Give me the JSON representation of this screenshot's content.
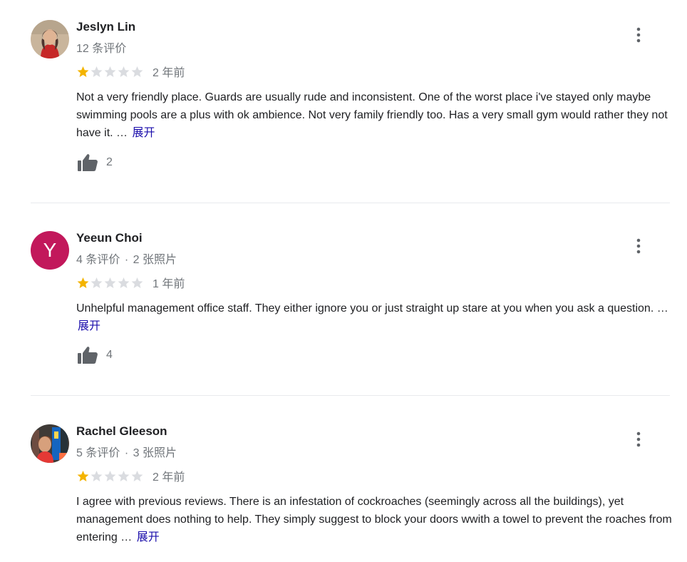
{
  "reviews": [
    {
      "author": "Jeslyn Lin",
      "meta": "12 条评价",
      "photos": "",
      "rating": 1,
      "max_rating": 5,
      "time": "2 年前",
      "text": "Not a very friendly place. Guards are usually rude and inconsistent. One of the worst place i've stayed only maybe swimming pools are a plus with ok ambience. Not very family friendly too. Has a very small gym would rather they not have it. …",
      "more": "展开",
      "likes": "2"
    },
    {
      "author": "Yeeun Choi",
      "avatar_letter": "Y",
      "meta": "4 条评价",
      "separator": "·",
      "photos": "2 张照片",
      "rating": 1,
      "max_rating": 5,
      "time": "1 年前",
      "text": "Unhelpful management office staff. They either ignore you or just straight up stare at you when you ask a question. …",
      "more": "展开",
      "likes": "4"
    },
    {
      "author": "Rachel Gleeson",
      "meta": "5 条评价",
      "separator": "·",
      "photos": "3 张照片",
      "rating": 1,
      "max_rating": 5,
      "time": "2 年前",
      "text": "I agree with previous reviews. There is an infestation of cockroaches (seemingly across all the buildings), yet management does nothing to help. They simply suggest to block your doors wwith a towel to prevent the roaches from entering …",
      "more": "展开"
    }
  ],
  "colors": {
    "star_filled": "#f4b400",
    "star_empty": "#dadce0",
    "link": "#1a0dab",
    "secondary_text": "#70757a",
    "avatar_y_bg": "#c2185b",
    "icon": "#5f6368"
  },
  "icons": {
    "like": "thumb-up-icon",
    "menu": "more-vert-icon",
    "star": "star-icon"
  }
}
